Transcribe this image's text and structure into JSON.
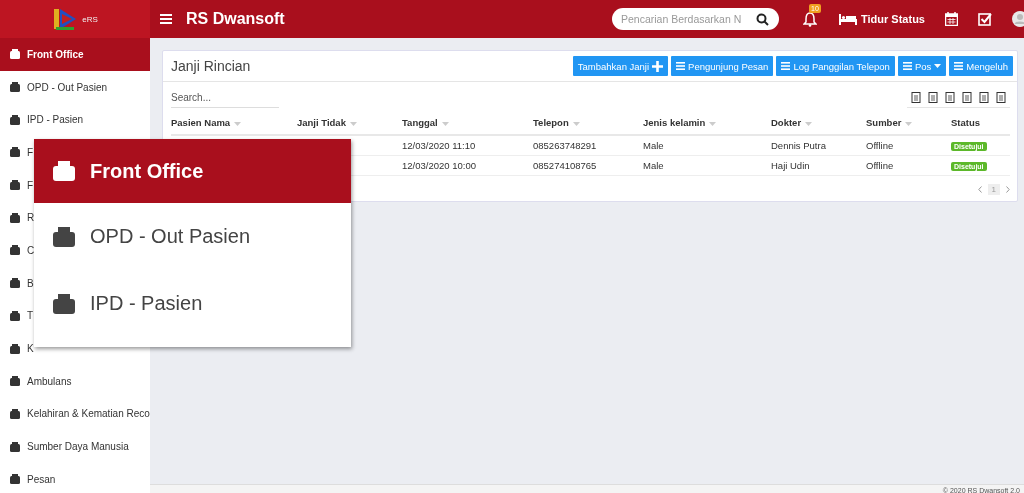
{
  "brand": {
    "logo_text": "eRS",
    "title": "RS Dwansoft"
  },
  "topbar": {
    "search_placeholder": "Pencarian Berdasarkan N",
    "notification_count": "10",
    "bed_status": "Tidur Status"
  },
  "sidebar": {
    "items": [
      {
        "label": "Front Office",
        "selected": true
      },
      {
        "label": "OPD - Out Pasien",
        "selected": false
      },
      {
        "label": "IPD - Pasien",
        "selected": false
      },
      {
        "label": "F",
        "selected": false
      },
      {
        "label": "F",
        "selected": false
      },
      {
        "label": "R",
        "selected": false
      },
      {
        "label": "C",
        "selected": false
      },
      {
        "label": "B",
        "selected": false
      },
      {
        "label": "T",
        "selected": false
      },
      {
        "label": "K",
        "selected": false
      },
      {
        "label": "Ambulans",
        "selected": false
      },
      {
        "label": "Kelahiran & Kematian Reco",
        "selected": false
      },
      {
        "label": "Sumber Daya Manusia",
        "selected": false
      },
      {
        "label": "Pesan",
        "selected": false
      }
    ]
  },
  "popup": {
    "items": [
      {
        "label": "Front Office",
        "selected": true
      },
      {
        "label": "OPD - Out Pasien",
        "selected": false
      },
      {
        "label": "IPD - Pasien",
        "selected": false
      }
    ]
  },
  "card": {
    "title": "Janji Rincian",
    "buttons": [
      {
        "label": "Tambahkan Janji",
        "kind": "add"
      },
      {
        "label": "Pengunjung Pesan",
        "kind": "list"
      },
      {
        "label": "Log Panggilan Telepon",
        "kind": "list"
      },
      {
        "label": "Pos",
        "kind": "dropdown"
      },
      {
        "label": "Mengeluh",
        "kind": "list"
      }
    ],
    "search_placeholder": "Search...",
    "table": {
      "columns": [
        "Pasien Nama",
        "Janji Tidak",
        "Tanggal",
        "Telepon",
        "Jenis kelamin",
        "Dokter",
        "Sumber",
        "Status"
      ],
      "rows": [
        {
          "tanggal": "12/03/2020 11:10",
          "telepon": "085263748291",
          "jenis_kelamin": "Male",
          "dokter": "Dennis Putra",
          "sumber": "Offline",
          "status": "Disetujui"
        },
        {
          "tanggal": "12/03/2020 10:00",
          "telepon": "085274108765",
          "jenis_kelamin": "Male",
          "dokter": "Haji Udin",
          "sumber": "Offline",
          "status": "Disetujui"
        }
      ]
    },
    "pagination": {
      "pages": [
        {
          "label": "1",
          "selected": true
        }
      ]
    }
  },
  "footer": {
    "text": "© 2020 RS Dwansoft 2.0"
  }
}
